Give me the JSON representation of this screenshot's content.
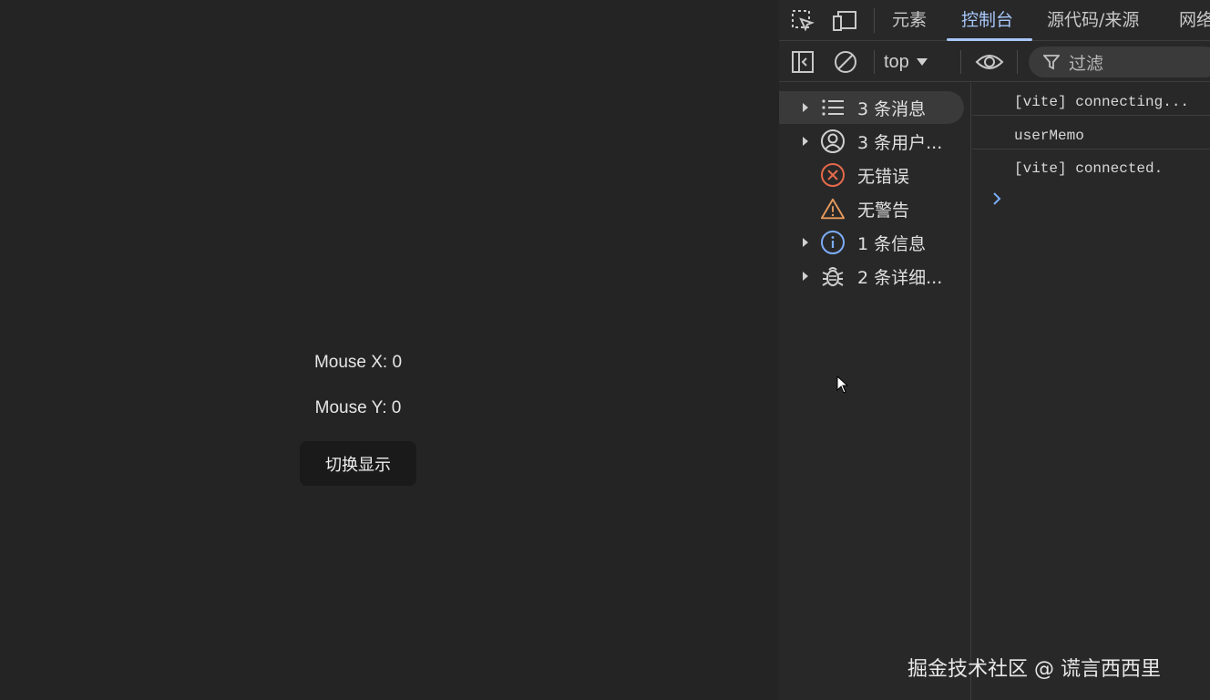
{
  "app": {
    "mouse_x_label": "Mouse X: 0",
    "mouse_y_label": "Mouse Y: 0",
    "toggle_button_label": "切换显示"
  },
  "devtools": {
    "tabs": [
      {
        "label": "元素",
        "active": false
      },
      {
        "label": "控制台",
        "active": true
      },
      {
        "label": "源代码/来源",
        "active": false
      },
      {
        "label": "网络",
        "active": false
      }
    ],
    "toolbar": {
      "context": "top",
      "filter_placeholder": "过滤"
    },
    "sidebar": [
      {
        "label": "3 条消息",
        "icon": "list-icon",
        "expandable": true,
        "selected": true
      },
      {
        "label": "3 条用户...",
        "icon": "user-icon",
        "expandable": true,
        "selected": false
      },
      {
        "label": "无错误",
        "icon": "error-icon",
        "expandable": false,
        "selected": false
      },
      {
        "label": "无警告",
        "icon": "warning-icon",
        "expandable": false,
        "selected": false
      },
      {
        "label": "1 条信息",
        "icon": "info-icon",
        "expandable": true,
        "selected": false
      },
      {
        "label": "2 条详细...",
        "icon": "bug-icon",
        "expandable": true,
        "selected": false
      }
    ],
    "messages": [
      "[vite] connecting...",
      "userMemo",
      "[vite] connected."
    ]
  },
  "watermark": "掘金技术社区 @ 谎言西西里",
  "colors": {
    "accent": "#a8c7fa",
    "error": "#e46a4b",
    "warning": "#e89a5c",
    "info": "#7cacf8",
    "background": "#242424"
  }
}
